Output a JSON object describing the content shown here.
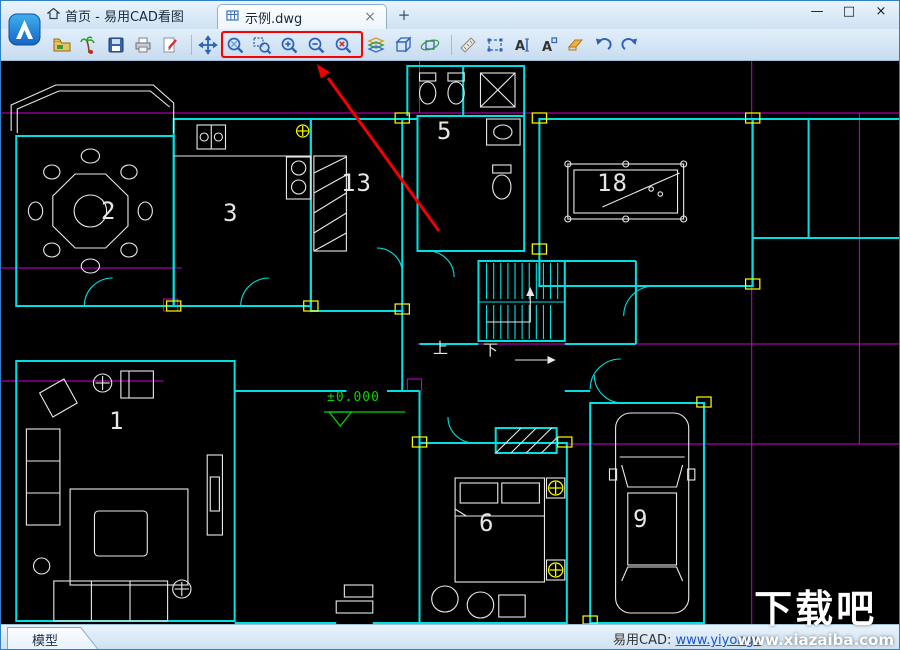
{
  "window": {
    "home_title": "首页 - 易用CAD看图",
    "doc_tab": {
      "label": "示例.dwg",
      "close": "×"
    },
    "new_tab_label": "+",
    "controls": {
      "minimize": "—",
      "maximize": "□",
      "close": "×"
    }
  },
  "toolbar": {
    "items": [
      "open-file-icon",
      "browse-palm-icon",
      "save-icon",
      "print-icon",
      "edit-drawing-icon",
      "pan-icon",
      "zoom-extents-icon",
      "zoom-window-icon",
      "zoom-in-icon",
      "zoom-out-icon",
      "zoom-previous-icon",
      "layers-icon",
      "view-3d-icon",
      "orbit-icon",
      "measure-icon",
      "area-measure-icon",
      "annotate-text-icon",
      "text-style-icon",
      "eraser-icon",
      "undo-icon",
      "redo-icon"
    ],
    "highlight_color": "#ff0000"
  },
  "canvas": {
    "background": "#000000",
    "colors": {
      "walls": "#00e0e0",
      "furniture": "#e8e8e8",
      "axes": "#cf00cf",
      "accents": "#ffff00",
      "elevation": "#00d800"
    },
    "rooms": [
      {
        "label": "2"
      },
      {
        "label": "3"
      },
      {
        "label": "13"
      },
      {
        "label": "5"
      },
      {
        "label": "18"
      },
      {
        "label": "1"
      },
      {
        "label": "6"
      },
      {
        "label": "9"
      }
    ],
    "stair_up": "上",
    "stair_down": "下",
    "elevation_label": "±0.000"
  },
  "statusbar": {
    "model_tab": "模型",
    "vendor_prefix": "易用CAD: ",
    "vendor_link": "www.yiyongc"
  },
  "watermark": {
    "title": "下载吧",
    "url": "www.xiazaiba.com"
  }
}
